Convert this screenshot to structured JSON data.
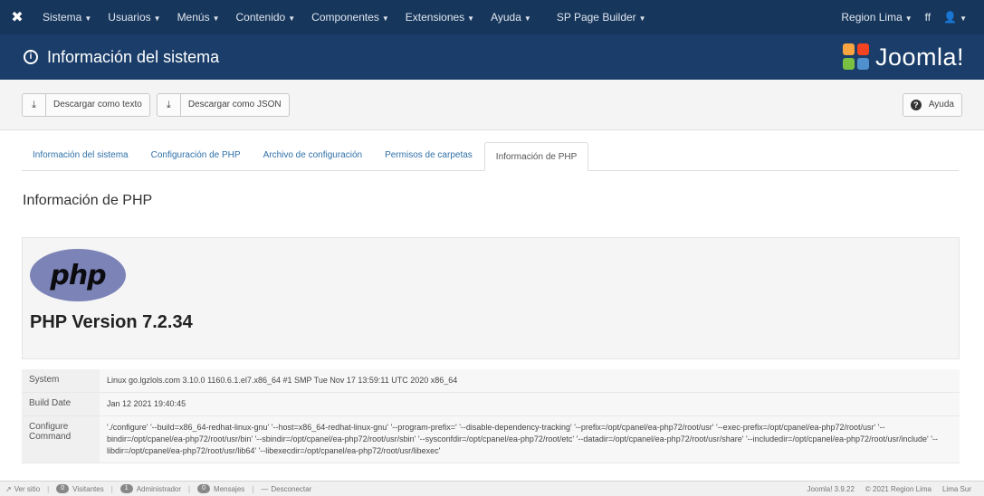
{
  "navbar": {
    "logo_icon": "joomla-icon",
    "items": [
      {
        "label": "Sistema"
      },
      {
        "label": "Usuarios"
      },
      {
        "label": "Menús"
      },
      {
        "label": "Contenido"
      },
      {
        "label": "Componentes"
      },
      {
        "label": "Extensiones"
      },
      {
        "label": "Ayuda"
      },
      {
        "label": "SP Page Builder"
      }
    ],
    "site_label": "Region Lima",
    "lang_label": "ff",
    "user_icon": "user-icon"
  },
  "header": {
    "title": "Información del sistema",
    "brand": "Joomla!",
    "brand_colors": [
      "#f9a541",
      "#f44321",
      "#5091cd",
      "#7ac143"
    ]
  },
  "toolbar": {
    "download_text": "Descargar como texto",
    "download_json": "Descargar como JSON",
    "help": "Ayuda"
  },
  "tabs": [
    {
      "label": "Información del sistema",
      "active": false
    },
    {
      "label": "Configuración de PHP",
      "active": false
    },
    {
      "label": "Archivo de configuración",
      "active": false
    },
    {
      "label": "Permisos de carpetas",
      "active": false
    },
    {
      "label": "Información de PHP",
      "active": true
    }
  ],
  "main": {
    "section_title": "Información de PHP",
    "php_logo_text": "php",
    "php_version": "PHP Version 7.2.34",
    "rows": [
      {
        "key": "System",
        "value": "Linux go.lgzlols.com 3.10.0 1160.6.1.el7.x86_64 #1 SMP Tue Nov 17 13:59:11 UTC 2020 x86_64"
      },
      {
        "key": "Build Date",
        "value": "Jan 12 2021 19:40:45"
      },
      {
        "key": "Configure Command",
        "value": "'./configure' '--build=x86_64-redhat-linux-gnu' '--host=x86_64-redhat-linux-gnu' '--program-prefix=' '--disable-dependency-tracking' '--prefix=/opt/cpanel/ea-php72/root/usr' '--exec-prefix=/opt/cpanel/ea-php72/root/usr' '--bindir=/opt/cpanel/ea-php72/root/usr/bin' '--sbindir=/opt/cpanel/ea-php72/root/usr/sbin' '--sysconfdir=/opt/cpanel/ea-php72/root/etc' '--datadir=/opt/cpanel/ea-php72/root/usr/share' '--includedir=/opt/cpanel/ea-php72/root/usr/include' '--libdir=/opt/cpanel/ea-php72/root/usr/lib64' '--libexecdir=/opt/cpanel/ea-php72/root/usr/libexec'"
      }
    ]
  },
  "statusbar": {
    "view_site": "Ver sitio",
    "visitors_count": "0",
    "visitors_label": "Visitantes",
    "admins_count": "1",
    "admins_label": "Administrador",
    "messages_count": "0",
    "messages_label": "Mensajes",
    "logout": "Desconectar",
    "version": "Joomla! 3.9.22",
    "copyright": "© 2021 Region Lima",
    "extra": "Lima Sur"
  }
}
